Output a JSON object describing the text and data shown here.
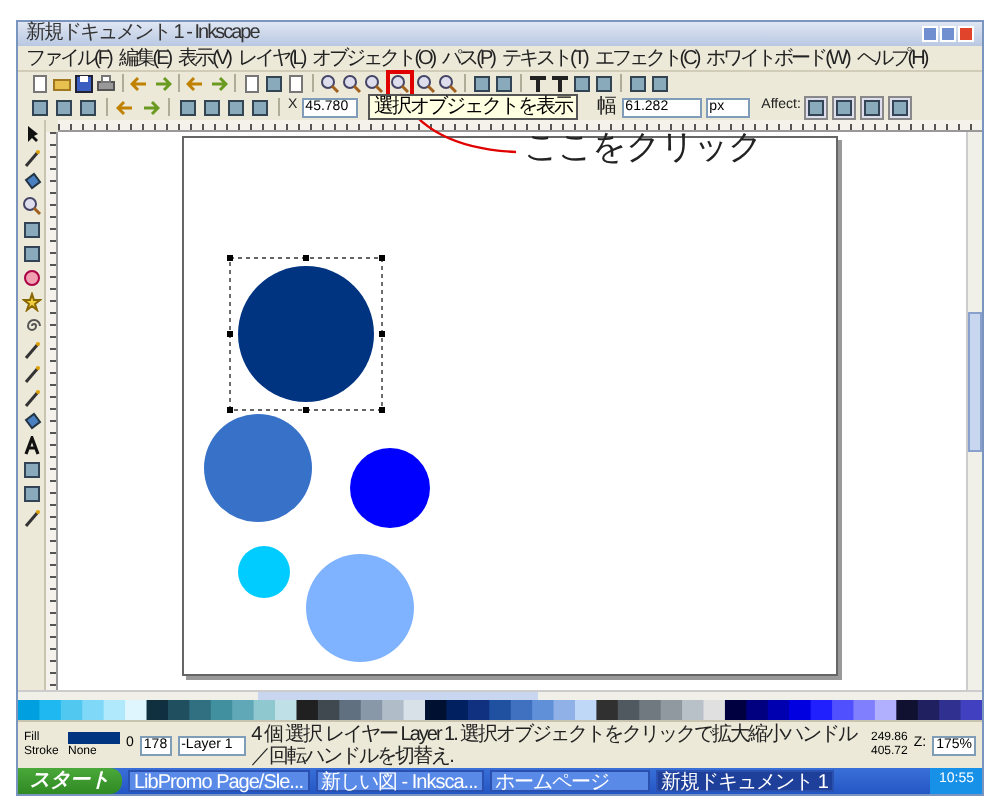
{
  "window": {
    "title": "新規ドキュメント 1 - Inkscape"
  },
  "menu": [
    "ファイル(F)",
    "編集(E)",
    "表示(V)",
    "レイヤ(L)",
    "オブジェクト(O)",
    "パス(P)",
    "テキスト(T)",
    "エフェクト(C)",
    "ホワイトボード(W)",
    "ヘルプ(H)"
  ],
  "tooltip": "選択オブジェクトを表示",
  "tool_controls": {
    "x_label": "X",
    "x_value": "45.780",
    "w_label": "幅",
    "w_value": "61.282",
    "unit": "px",
    "affect_label": "Affect:"
  },
  "objects": [
    {
      "color": "#003380",
      "selected": true
    },
    {
      "color": "#3771c8",
      "selected": false
    },
    {
      "color": "#0000ff",
      "selected": false
    },
    {
      "color": "#00ccff",
      "selected": false
    },
    {
      "color": "#80b3ff",
      "selected": false
    }
  ],
  "status_bar": {
    "fill_label": "Fill",
    "stroke_label": "Stroke",
    "stroke_value": "None",
    "opacity_label": "0",
    "opacity_value": "178",
    "layer": "-Layer 1",
    "message": "4 個 選択 レイヤー Layer 1. 選択オブジェクトをクリックで拡大縮小ハンドル／回転ハンドルを切替え.",
    "x_coord": "249.86",
    "y_coord": "405.72",
    "zoom_label": "Z:",
    "zoom_value": "175%"
  },
  "taskbar": {
    "start": "スタート",
    "tasks": [
      {
        "label": "LibPromo Page/Sle...",
        "selected": false
      },
      {
        "label": "新しい図 - Inksca...",
        "selected": false
      },
      {
        "label": "ホームページ",
        "selected": false
      },
      {
        "label": "新規ドキュメント 1",
        "selected": true
      }
    ],
    "clock": "10:55"
  },
  "annotation": {
    "label": "ここをクリック"
  }
}
